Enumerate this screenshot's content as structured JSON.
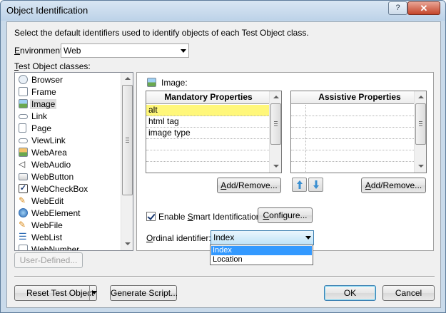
{
  "window": {
    "title": "Object Identification",
    "help_glyph": "?",
    "close_glyph": "✕"
  },
  "instructions": "Select the default identifiers used to identify objects of each Test Object class.",
  "environment": {
    "label_accel": "E",
    "label_rest": "nvironment:",
    "value": "Web"
  },
  "classes": {
    "label_accel": "T",
    "label_rest": "est Object classes:",
    "items": [
      {
        "label": "Browser",
        "icon": "browser-icon"
      },
      {
        "label": "Frame",
        "icon": "frame-icon"
      },
      {
        "label": "Image",
        "icon": "image-icon"
      },
      {
        "label": "Link",
        "icon": "link-icon"
      },
      {
        "label": "Page",
        "icon": "page-icon"
      },
      {
        "label": "ViewLink",
        "icon": "viewlink-icon"
      },
      {
        "label": "WebArea",
        "icon": "webarea-icon"
      },
      {
        "label": "WebAudio",
        "icon": "speaker-icon"
      },
      {
        "label": "WebButton",
        "icon": "button-icon"
      },
      {
        "label": "WebCheckBox",
        "icon": "checkbox-icon"
      },
      {
        "label": "WebEdit",
        "icon": "pencil-icon"
      },
      {
        "label": "WebElement",
        "icon": "globe-icon"
      },
      {
        "label": "WebFile",
        "icon": "file-edit-icon"
      },
      {
        "label": "WebList",
        "icon": "list-icon"
      },
      {
        "label": "WebNumber",
        "icon": "number-icon"
      }
    ],
    "selected": "Image"
  },
  "user_defined_button": "User-Defined...",
  "details": {
    "class_name": "Image:",
    "mandatory": {
      "header": "Mandatory Properties",
      "rows": [
        "alt",
        "html tag",
        "image type",
        "",
        "",
        ""
      ]
    },
    "assistive": {
      "header": "Assistive Properties",
      "rows": [
        "",
        "",
        "",
        "",
        "",
        ""
      ]
    },
    "add_remove_mandatory": "Add/Remove...",
    "add_remove_assistive": "Add/Remove...",
    "smart_identification": {
      "checked": true,
      "label_pre": "Enable ",
      "label_accel": "S",
      "label_post": "mart Identification:",
      "configure_button": "Configure..."
    },
    "ordinal_identifier": {
      "label_accel": "O",
      "label_rest": "rdinal identifier:",
      "value": "Index",
      "options": [
        "Index",
        "Location"
      ]
    }
  },
  "footer": {
    "reset_button": "Reset Test Object",
    "generate_button": "Generate Script...",
    "ok_button": "OK",
    "cancel_button": "Cancel"
  },
  "colors": {
    "highlight_row": "#fff77a",
    "selection": "#3399ff"
  }
}
